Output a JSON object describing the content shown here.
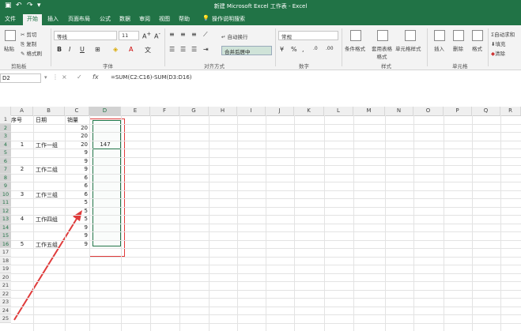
{
  "window": {
    "title": "新建 Microsoft Excel 工作表 - Excel"
  },
  "tabs": [
    "文件",
    "开始",
    "插入",
    "页面布局",
    "公式",
    "数据",
    "审阅",
    "视图",
    "帮助",
    "操作说明搜索"
  ],
  "ribbon": {
    "clipboard": {
      "paste": "粘贴",
      "cut": "剪切",
      "copy": "复制",
      "format_painter": "格式刷",
      "group": "剪贴板"
    },
    "font": {
      "name": "等线",
      "size": "11",
      "group": "字体",
      "bold": "B",
      "italic": "I",
      "underline": "U"
    },
    "alignment": {
      "wrap": "自动换行",
      "merge": "合并后居中",
      "group": "对齐方式"
    },
    "number": {
      "format": "常规",
      "group": "数字"
    },
    "styles": {
      "conditional": "条件格式",
      "table": "套用表格格式",
      "cell": "单元格样式",
      "group": "样式"
    },
    "cells": {
      "insert": "插入",
      "delete": "删除",
      "format": "格式",
      "group": "单元格"
    },
    "editing": {
      "autosum": "自动求和",
      "fill": "填充",
      "clear": "清除"
    }
  },
  "formula_bar": {
    "name_box": "D2",
    "cancel": "×",
    "enter": "✓",
    "fx": "fx",
    "formula": "=SUM(C2:C16)-SUM(D3:D16)"
  },
  "columns": [
    "A",
    "B",
    "C",
    "D",
    "E",
    "F",
    "G",
    "H",
    "I",
    "J",
    "K",
    "L",
    "M",
    "N",
    "O",
    "P",
    "Q",
    "R"
  ],
  "rows": [
    "1",
    "2",
    "3",
    "4",
    "5",
    "6",
    "7",
    "8",
    "9",
    "10",
    "11",
    "12",
    "13",
    "14",
    "15",
    "16",
    "17",
    "18",
    "19",
    "20",
    "21",
    "22",
    "23",
    "24",
    "25"
  ],
  "cells": {
    "A1": "序号",
    "B1": "日期",
    "C1": "销量",
    "A4": "1",
    "B4": "工作一组",
    "A7": "2",
    "B7": "工作二组",
    "A10": "3",
    "B10": "工作三组",
    "A13": "4",
    "B13": "工作四组",
    "A16": "5",
    "B16": "工作五组",
    "D4": "147"
  },
  "c_values": [
    "20",
    "20",
    "20",
    "9",
    "9",
    "9",
    "6",
    "6",
    "6",
    "5",
    "5",
    "5",
    "9",
    "9",
    "9"
  ],
  "colors": {
    "accent": "#217346",
    "annotation": "#e03b3b"
  }
}
